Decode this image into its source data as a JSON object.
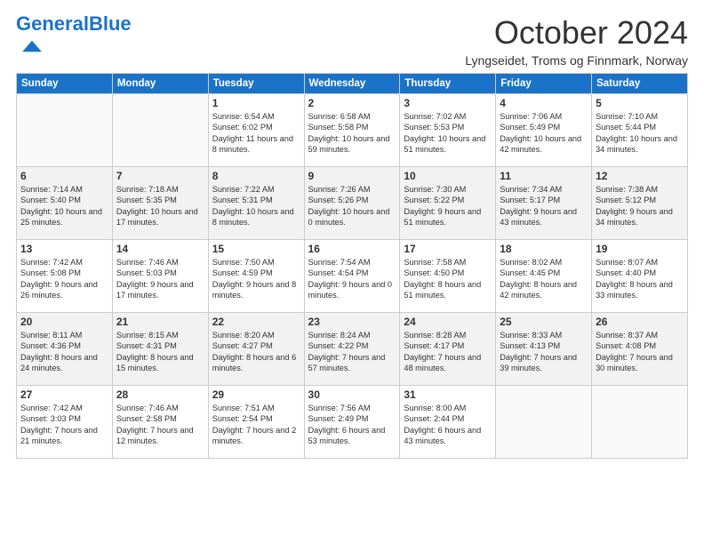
{
  "header": {
    "logo_text_general": "General",
    "logo_text_blue": "Blue",
    "month": "October 2024",
    "location": "Lyngseidet, Troms og Finnmark, Norway"
  },
  "days_of_week": [
    "Sunday",
    "Monday",
    "Tuesday",
    "Wednesday",
    "Thursday",
    "Friday",
    "Saturday"
  ],
  "weeks": [
    [
      {
        "day": "",
        "sunrise": "",
        "sunset": "",
        "daylight": ""
      },
      {
        "day": "",
        "sunrise": "",
        "sunset": "",
        "daylight": ""
      },
      {
        "day": "1",
        "sunrise": "Sunrise: 6:54 AM",
        "sunset": "Sunset: 6:02 PM",
        "daylight": "Daylight: 11 hours and 8 minutes."
      },
      {
        "day": "2",
        "sunrise": "Sunrise: 6:58 AM",
        "sunset": "Sunset: 5:58 PM",
        "daylight": "Daylight: 10 hours and 59 minutes."
      },
      {
        "day": "3",
        "sunrise": "Sunrise: 7:02 AM",
        "sunset": "Sunset: 5:53 PM",
        "daylight": "Daylight: 10 hours and 51 minutes."
      },
      {
        "day": "4",
        "sunrise": "Sunrise: 7:06 AM",
        "sunset": "Sunset: 5:49 PM",
        "daylight": "Daylight: 10 hours and 42 minutes."
      },
      {
        "day": "5",
        "sunrise": "Sunrise: 7:10 AM",
        "sunset": "Sunset: 5:44 PM",
        "daylight": "Daylight: 10 hours and 34 minutes."
      }
    ],
    [
      {
        "day": "6",
        "sunrise": "Sunrise: 7:14 AM",
        "sunset": "Sunset: 5:40 PM",
        "daylight": "Daylight: 10 hours and 25 minutes."
      },
      {
        "day": "7",
        "sunrise": "Sunrise: 7:18 AM",
        "sunset": "Sunset: 5:35 PM",
        "daylight": "Daylight: 10 hours and 17 minutes."
      },
      {
        "day": "8",
        "sunrise": "Sunrise: 7:22 AM",
        "sunset": "Sunset: 5:31 PM",
        "daylight": "Daylight: 10 hours and 8 minutes."
      },
      {
        "day": "9",
        "sunrise": "Sunrise: 7:26 AM",
        "sunset": "Sunset: 5:26 PM",
        "daylight": "Daylight: 10 hours and 0 minutes."
      },
      {
        "day": "10",
        "sunrise": "Sunrise: 7:30 AM",
        "sunset": "Sunset: 5:22 PM",
        "daylight": "Daylight: 9 hours and 51 minutes."
      },
      {
        "day": "11",
        "sunrise": "Sunrise: 7:34 AM",
        "sunset": "Sunset: 5:17 PM",
        "daylight": "Daylight: 9 hours and 43 minutes."
      },
      {
        "day": "12",
        "sunrise": "Sunrise: 7:38 AM",
        "sunset": "Sunset: 5:12 PM",
        "daylight": "Daylight: 9 hours and 34 minutes."
      }
    ],
    [
      {
        "day": "13",
        "sunrise": "Sunrise: 7:42 AM",
        "sunset": "Sunset: 5:08 PM",
        "daylight": "Daylight: 9 hours and 26 minutes."
      },
      {
        "day": "14",
        "sunrise": "Sunrise: 7:46 AM",
        "sunset": "Sunset: 5:03 PM",
        "daylight": "Daylight: 9 hours and 17 minutes."
      },
      {
        "day": "15",
        "sunrise": "Sunrise: 7:50 AM",
        "sunset": "Sunset: 4:59 PM",
        "daylight": "Daylight: 9 hours and 8 minutes."
      },
      {
        "day": "16",
        "sunrise": "Sunrise: 7:54 AM",
        "sunset": "Sunset: 4:54 PM",
        "daylight": "Daylight: 9 hours and 0 minutes."
      },
      {
        "day": "17",
        "sunrise": "Sunrise: 7:58 AM",
        "sunset": "Sunset: 4:50 PM",
        "daylight": "Daylight: 8 hours and 51 minutes."
      },
      {
        "day": "18",
        "sunrise": "Sunrise: 8:02 AM",
        "sunset": "Sunset: 4:45 PM",
        "daylight": "Daylight: 8 hours and 42 minutes."
      },
      {
        "day": "19",
        "sunrise": "Sunrise: 8:07 AM",
        "sunset": "Sunset: 4:40 PM",
        "daylight": "Daylight: 8 hours and 33 minutes."
      }
    ],
    [
      {
        "day": "20",
        "sunrise": "Sunrise: 8:11 AM",
        "sunset": "Sunset: 4:36 PM",
        "daylight": "Daylight: 8 hours and 24 minutes."
      },
      {
        "day": "21",
        "sunrise": "Sunrise: 8:15 AM",
        "sunset": "Sunset: 4:31 PM",
        "daylight": "Daylight: 8 hours and 15 minutes."
      },
      {
        "day": "22",
        "sunrise": "Sunrise: 8:20 AM",
        "sunset": "Sunset: 4:27 PM",
        "daylight": "Daylight: 8 hours and 6 minutes."
      },
      {
        "day": "23",
        "sunrise": "Sunrise: 8:24 AM",
        "sunset": "Sunset: 4:22 PM",
        "daylight": "Daylight: 7 hours and 57 minutes."
      },
      {
        "day": "24",
        "sunrise": "Sunrise: 8:28 AM",
        "sunset": "Sunset: 4:17 PM",
        "daylight": "Daylight: 7 hours and 48 minutes."
      },
      {
        "day": "25",
        "sunrise": "Sunrise: 8:33 AM",
        "sunset": "Sunset: 4:13 PM",
        "daylight": "Daylight: 7 hours and 39 minutes."
      },
      {
        "day": "26",
        "sunrise": "Sunrise: 8:37 AM",
        "sunset": "Sunset: 4:08 PM",
        "daylight": "Daylight: 7 hours and 30 minutes."
      }
    ],
    [
      {
        "day": "27",
        "sunrise": "Sunrise: 7:42 AM",
        "sunset": "Sunset: 3:03 PM",
        "daylight": "Daylight: 7 hours and 21 minutes."
      },
      {
        "day": "28",
        "sunrise": "Sunrise: 7:46 AM",
        "sunset": "Sunset: 2:58 PM",
        "daylight": "Daylight: 7 hours and 12 minutes."
      },
      {
        "day": "29",
        "sunrise": "Sunrise: 7:51 AM",
        "sunset": "Sunset: 2:54 PM",
        "daylight": "Daylight: 7 hours and 2 minutes."
      },
      {
        "day": "30",
        "sunrise": "Sunrise: 7:56 AM",
        "sunset": "Sunset: 2:49 PM",
        "daylight": "Daylight: 6 hours and 53 minutes."
      },
      {
        "day": "31",
        "sunrise": "Sunrise: 8:00 AM",
        "sunset": "Sunset: 2:44 PM",
        "daylight": "Daylight: 6 hours and 43 minutes."
      },
      {
        "day": "",
        "sunrise": "",
        "sunset": "",
        "daylight": ""
      },
      {
        "day": "",
        "sunrise": "",
        "sunset": "",
        "daylight": ""
      }
    ]
  ]
}
